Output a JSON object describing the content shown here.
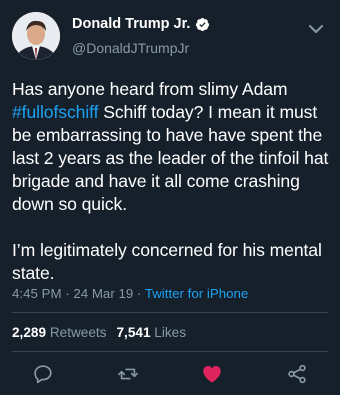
{
  "user": {
    "display_name": "Donald Trump Jr.",
    "handle": "@DonaldJTrumpJr",
    "verified": true
  },
  "tweet": {
    "paragraph1_before": "Has anyone heard from slimy Adam ",
    "hashtag": "#fullofschiff",
    "paragraph1_after": " Schiff today? I mean it must be embarrassing to have have spent the last 2 years as the leader of the tinfoil hat brigade and have it all come crashing down so quick.",
    "paragraph2": "I’m legitimately concerned for his mental state."
  },
  "meta": {
    "time": "4:45 PM",
    "separator": " · ",
    "date": "24 Mar 19",
    "separator2": " · ",
    "source": "Twitter for iPhone"
  },
  "stats": {
    "retweets_count": "2,289",
    "retweets_label": "Retweets",
    "likes_count": "7,541",
    "likes_label": "Likes"
  },
  "actions": {
    "reply_icon": "reply-icon",
    "retweet_icon": "retweet-icon",
    "like_icon": "heart-icon",
    "share_icon": "share-icon",
    "liked": true
  },
  "colors": {
    "background": "#15202b",
    "accent": "#1da1f2",
    "secondary_text": "#8899a6",
    "like": "#e0245e"
  }
}
